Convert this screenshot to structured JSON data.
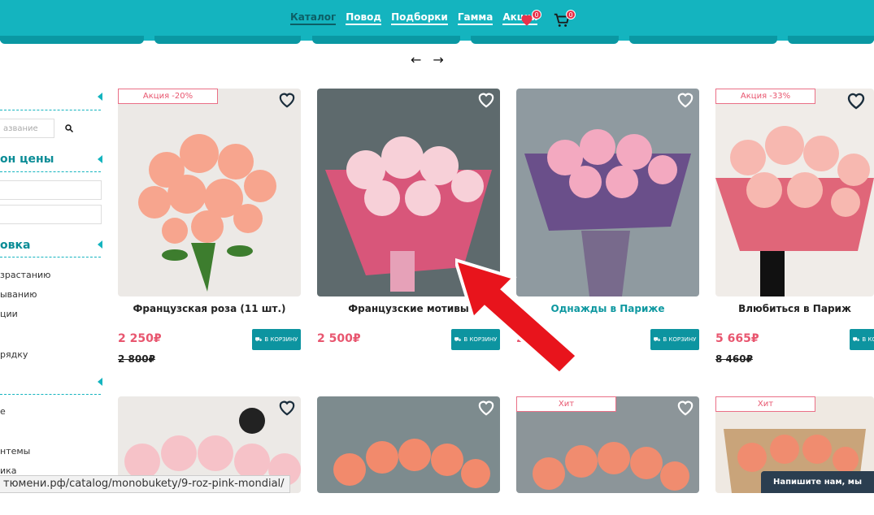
{
  "nav": {
    "items": [
      "Каталог",
      "Повод",
      "Подборки",
      "Гамма",
      "Акции"
    ],
    "favorites_count": "0",
    "cart_count": "0"
  },
  "slider": {
    "prev_icon": "←",
    "next_icon": "→"
  },
  "sidebar": {
    "search_placeholder": "азвание",
    "price_title": "он цены",
    "sort_title": "овка",
    "sort_links": [
      "зрастанию",
      "ыванию",
      "ции",
      "",
      "рядку"
    ],
    "filter_links": [
      "е",
      "",
      "нтемы",
      "ика"
    ]
  },
  "products": [
    {
      "tag": "Акция -20%",
      "name": "Французская роза (11 шт.)",
      "price": "2 250₽",
      "old_price": "2 800₽",
      "cart_label": "В КОРЗИНУ",
      "highlight": false
    },
    {
      "tag": "",
      "name": "Французские мотивы",
      "price": "2 500₽",
      "old_price": "",
      "cart_label": "В КОРЗИНУ",
      "highlight": false
    },
    {
      "tag": "",
      "name": "Однажды в Париже",
      "price": "2",
      "old_price": "",
      "cart_label": "В КОРЗИНУ",
      "highlight": true
    },
    {
      "tag": "Акция -33%",
      "name": "Влюбиться в Париж",
      "price": "5 665₽",
      "old_price": "8 460₽",
      "cart_label": "В КОРЗИНУ",
      "highlight": false
    },
    {
      "tag": "",
      "name": "",
      "price": "",
      "old_price": "",
      "cart_label": "",
      "highlight": false
    },
    {
      "tag": "",
      "name": "",
      "price": "",
      "old_price": "",
      "cart_label": "",
      "highlight": false
    },
    {
      "tag": "Хит",
      "name": "",
      "price": "",
      "old_price": "",
      "cart_label": "",
      "highlight": false
    },
    {
      "tag": "Хит",
      "name": "",
      "price": "",
      "old_price": "",
      "cart_label": "",
      "highlight": false
    }
  ],
  "statusbar": {
    "url": "тюмени.рф/catalog/monobukety/9-roz-pink-mondial/"
  },
  "chat": {
    "label": "Напишите нам, мы онлайн!"
  },
  "colors": {
    "accent": "#14b4bf",
    "button": "#0d94a0",
    "sale": "#e8566f",
    "arrow": "#e8141c"
  },
  "icons": {
    "favorites": "heart-icon",
    "cart": "cart-icon",
    "search": "search-icon",
    "wishlist": "heart-outline-icon",
    "annotation": "red-arrow-icon"
  }
}
